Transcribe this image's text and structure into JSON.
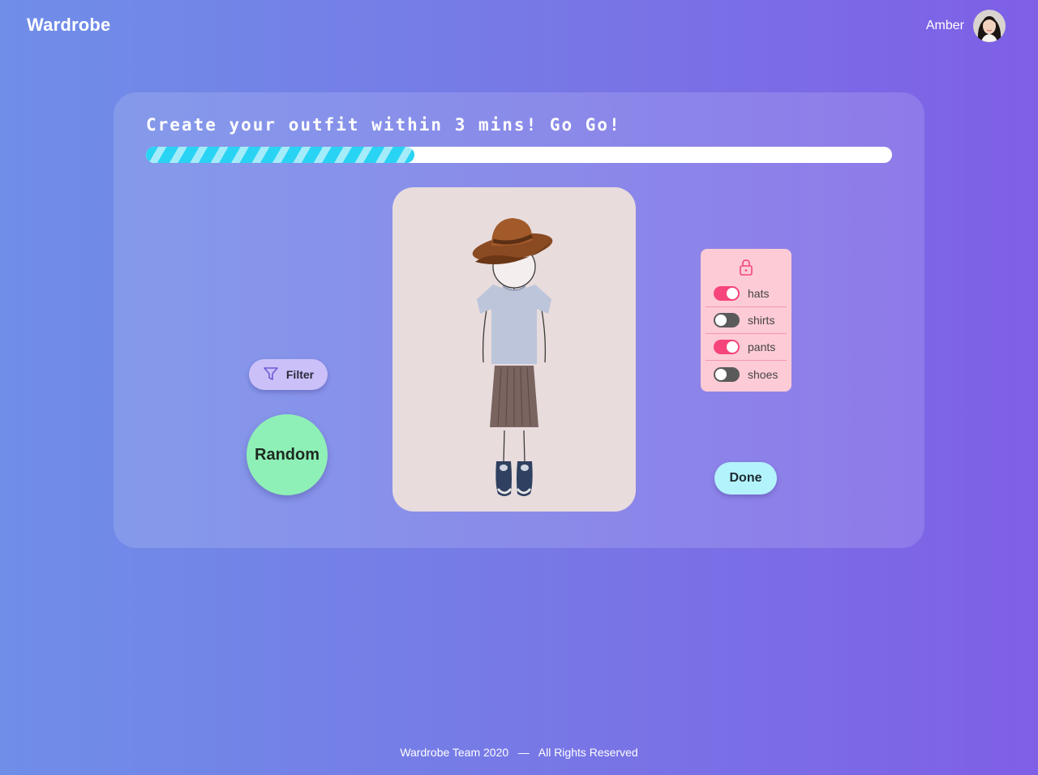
{
  "app": {
    "title": "Wardrobe",
    "user_name": "Amber",
    "avatar_icon": "user-avatar"
  },
  "challenge": {
    "headline": "Create your outfit within 3 mins! Go Go!",
    "progress_fraction": 0.36,
    "progress_color": "#29d3f3"
  },
  "outfit": {
    "items": [
      "hat-icon",
      "shirt-icon",
      "skirt-icon",
      "shoes-icon"
    ]
  },
  "actions": {
    "filter_label": "Filter",
    "filter_icon": "funnel-icon",
    "random_label": "Random",
    "done_label": "Done"
  },
  "lock_panel": {
    "icon": "lock-icon",
    "items": [
      {
        "label": "hats",
        "locked": true
      },
      {
        "label": "shirts",
        "locked": false
      },
      {
        "label": "pants",
        "locked": true
      },
      {
        "label": "shoes",
        "locked": false
      }
    ]
  },
  "footer": {
    "team": "Wardrobe Team 2020",
    "separator": "—",
    "rights": "All Rights Reserved"
  },
  "colors": {
    "background_start": "#6f8ee8",
    "background_end": "#7f5fe6",
    "toggle_on": "#f5457a",
    "toggle_off": "#5a5a5a",
    "random": "#8ef0b6",
    "done": "#b3f3fb",
    "filter": "#cbc0f8",
    "lock_panel": "#fdcbd6"
  }
}
